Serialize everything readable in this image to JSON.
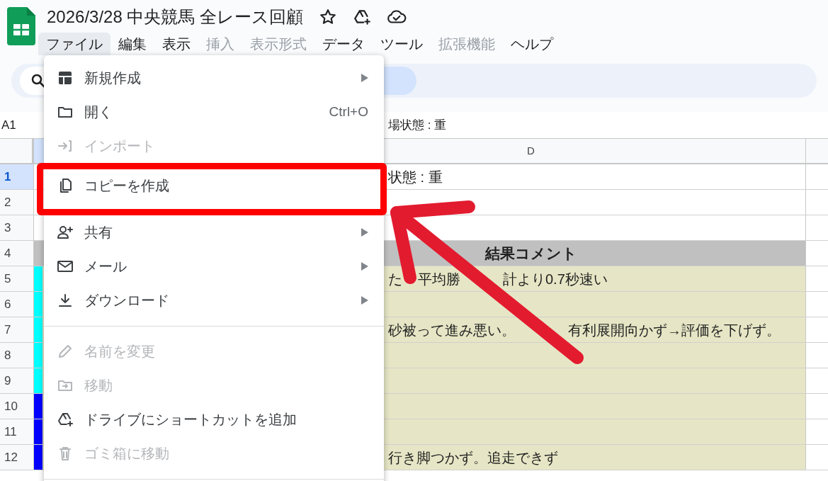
{
  "document": {
    "title": "2026/3/28 中央競馬 全レース回顧"
  },
  "menu_bar": [
    {
      "label": "ファイル",
      "selected": true,
      "disabled": false
    },
    {
      "label": "編集",
      "selected": false,
      "disabled": false
    },
    {
      "label": "表示",
      "selected": false,
      "disabled": false
    },
    {
      "label": "挿入",
      "selected": false,
      "disabled": true
    },
    {
      "label": "表示形式",
      "selected": false,
      "disabled": true
    },
    {
      "label": "データ",
      "selected": false,
      "disabled": false
    },
    {
      "label": "ツール",
      "selected": false,
      "disabled": false
    },
    {
      "label": "拡張機能",
      "selected": false,
      "disabled": true
    },
    {
      "label": "ヘルプ",
      "selected": false,
      "disabled": false
    }
  ],
  "formula_bar": {
    "cell": "A1",
    "value": "場状態 : 重"
  },
  "grid": {
    "column_header": "D",
    "rows": [
      {
        "number": "1",
        "selected": true,
        "kind": "plain",
        "text": [
          "状態 : 重"
        ]
      },
      {
        "number": "2",
        "selected": false,
        "kind": "plain"
      },
      {
        "number": "3",
        "selected": false,
        "kind": "plain"
      },
      {
        "number": "4",
        "selected": false,
        "kind": "header",
        "text": [
          "結果コメント"
        ]
      },
      {
        "number": "5",
        "selected": false,
        "kind": "comment",
        "color": "#00ffff",
        "text": [
          "た",
          "平均勝",
          "計より0.7秒速い"
        ]
      },
      {
        "number": "6",
        "selected": false,
        "kind": "comment",
        "color": "#00ffff"
      },
      {
        "number": "7",
        "selected": false,
        "kind": "comment",
        "color": "#00ffff",
        "text": [
          "砂被って進み悪い。",
          "有利展開向かず→評価を下げず。"
        ]
      },
      {
        "number": "8",
        "selected": false,
        "kind": "comment",
        "color": "#00ffff"
      },
      {
        "number": "9",
        "selected": false,
        "kind": "comment",
        "color": "#00ffff"
      },
      {
        "number": "10",
        "selected": false,
        "kind": "comment",
        "color": "#0000ff"
      },
      {
        "number": "11",
        "selected": false,
        "kind": "comment",
        "color": "#0000ff"
      },
      {
        "number": "12",
        "selected": false,
        "kind": "comment",
        "color": "#0000ff",
        "text": [
          "行き脚つかず。追走できず"
        ]
      }
    ]
  },
  "file_menu": [
    {
      "kind": "item",
      "label": "新規作成",
      "submenu": true,
      "disabled": false,
      "highlighted": false
    },
    {
      "kind": "item",
      "label": "開く",
      "shortcut": "Ctrl+O",
      "submenu": false,
      "disabled": false,
      "highlighted": false
    },
    {
      "kind": "item",
      "label": "インポート",
      "submenu": false,
      "disabled": true,
      "highlighted": false
    },
    {
      "kind": "item",
      "label": "コピーを作成",
      "submenu": false,
      "disabled": false,
      "highlighted": true
    },
    {
      "kind": "item",
      "label": "共有",
      "submenu": true,
      "disabled": false,
      "highlighted": false
    },
    {
      "kind": "item",
      "label": "メール",
      "submenu": true,
      "disabled": false,
      "highlighted": false
    },
    {
      "kind": "item",
      "label": "ダウンロード",
      "submenu": true,
      "disabled": false,
      "highlighted": false
    },
    {
      "kind": "divider"
    },
    {
      "kind": "item",
      "label": "名前を変更",
      "submenu": false,
      "disabled": true,
      "highlighted": false
    },
    {
      "kind": "item",
      "label": "移動",
      "submenu": false,
      "disabled": true,
      "highlighted": false
    },
    {
      "kind": "item",
      "label": "ドライブにショートカットを追加",
      "submenu": false,
      "disabled": false,
      "highlighted": false
    },
    {
      "kind": "item",
      "label": "ゴミ箱に移動",
      "submenu": false,
      "disabled": true,
      "highlighted": false
    },
    {
      "kind": "divider"
    }
  ]
}
